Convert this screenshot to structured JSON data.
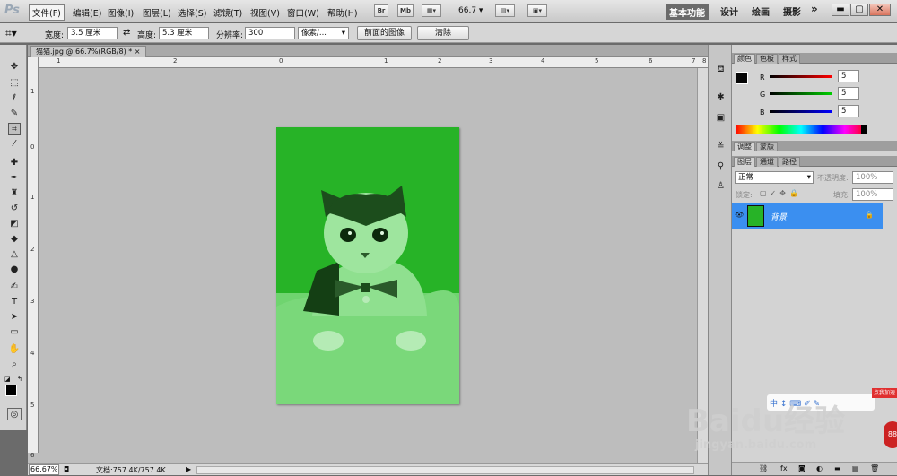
{
  "app": {
    "logo": "Ps"
  },
  "menu": [
    "文件(F)",
    "编辑(E)",
    "图像(I)",
    "图层(L)",
    "选择(S)",
    "滤镜(T)",
    "视图(V)",
    "窗口(W)",
    "帮助(H)"
  ],
  "menubar": {
    "br_label": "Br",
    "mb_label": "Mb",
    "zoom": "66.7",
    "workspaces": [
      "基本功能",
      "设计",
      "绘画",
      "摄影"
    ],
    "more": "»"
  },
  "options": {
    "width_label": "宽度:",
    "width_value": "3.5 厘米",
    "height_label": "高度:",
    "height_value": "5.3 厘米",
    "res_label": "分辨率:",
    "res_value": "300",
    "unit_value": "像素/...",
    "front_image": "前面的图像",
    "clear": "清除"
  },
  "document": {
    "tab_title": "猫猫.jpg @ 66.7%(RGB/8) *",
    "close": "×"
  },
  "ruler": {
    "h": [
      "1",
      "2",
      "0",
      "1",
      "2",
      "3",
      "4",
      "5",
      "6",
      "7",
      "8"
    ],
    "v": [
      "1",
      "0",
      "1",
      "2",
      "3",
      "4",
      "5",
      "6"
    ]
  },
  "status": {
    "zoom": "66.67%",
    "doc_info": "文档:757.4K/757.4K"
  },
  "color_panel": {
    "tabs": [
      "颜色",
      "色板",
      "样式"
    ],
    "r_label": "R",
    "g_label": "G",
    "b_label": "B",
    "r": "5",
    "g": "5",
    "b": "5"
  },
  "adjust_panel": {
    "tabs": [
      "调整",
      "蒙版"
    ]
  },
  "layers_panel": {
    "tabs": [
      "图层",
      "通道",
      "路径"
    ],
    "blend_mode": "正常",
    "opacity_label": "不透明度:",
    "opacity": "100%",
    "lock_label": "锁定:",
    "fill_label": "填充:",
    "fill": "100%",
    "layer_name": "背景"
  },
  "watermark": {
    "brand": "Baidu经验",
    "url": "jingyan.baidu.com",
    "badge": "点我加速"
  },
  "colors": {
    "image_green": "#27b327",
    "layer_selected": "#3b8ff0"
  }
}
